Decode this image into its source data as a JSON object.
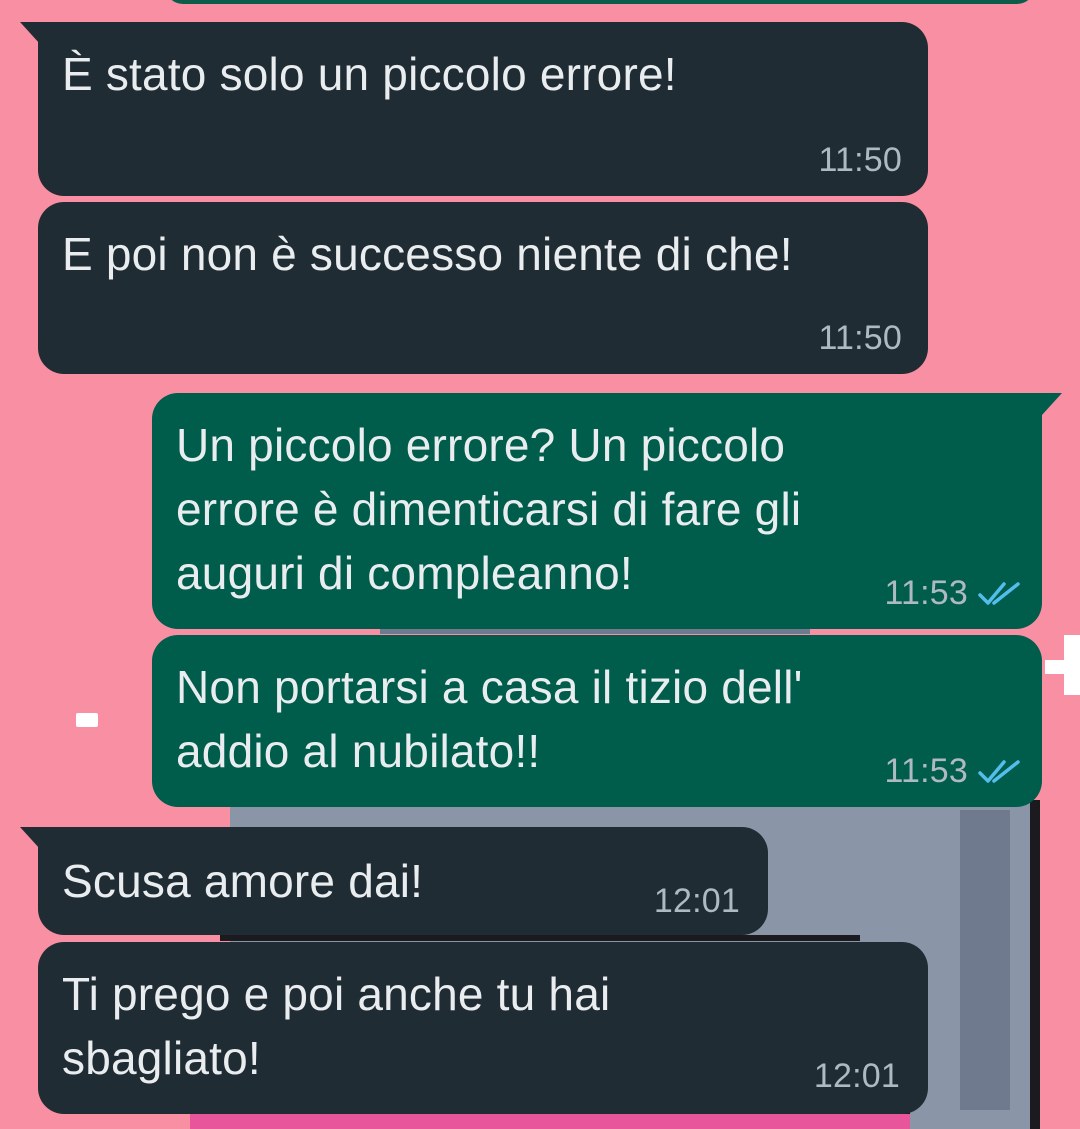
{
  "chat": {
    "messages": [
      {
        "direction": "incoming",
        "text": "È stato solo un piccolo errore!",
        "time": "11:50"
      },
      {
        "direction": "incoming",
        "text": "E poi non è successo niente di che!",
        "time": "11:50"
      },
      {
        "direction": "outgoing",
        "text": "Un piccolo errore? Un piccolo\nerrore è dimenticarsi di fare gli\nauguri di compleanno!",
        "time": "11:53",
        "status": "read"
      },
      {
        "direction": "outgoing",
        "text": "Non portarsi a casa il tizio dell'\naddio al nubilato!!",
        "time": "11:53",
        "status": "read"
      },
      {
        "direction": "incoming",
        "text": "Scusa amore dai!",
        "time": "12:01"
      },
      {
        "direction": "incoming",
        "text": "Ti prego e poi anche tu hai\nsbagliato!",
        "time": "12:01"
      }
    ]
  },
  "colors": {
    "wallpaper": "#f98fa2",
    "incoming_bubble": "#202c33",
    "outgoing_bubble": "#005c4b",
    "read_ticks": "#53bdeb"
  },
  "icons": {
    "read_status": "double-check-icon"
  }
}
